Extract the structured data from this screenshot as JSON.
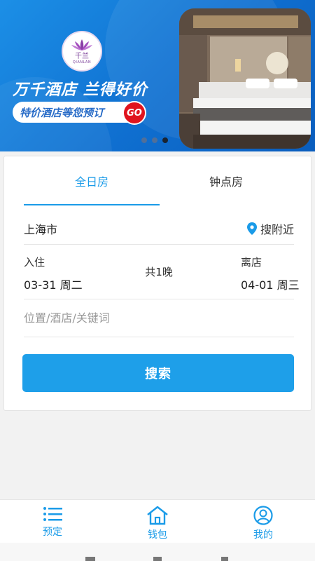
{
  "banner": {
    "logo_name": "千兰",
    "logo_sub": "QIANLAN",
    "slogan": "万千酒店 兰得好价",
    "pill_text": "特价酒店等您预订",
    "go_label": "GO",
    "carousel_count": 3,
    "carousel_active": 3
  },
  "tabs": {
    "all_day": "全日房",
    "hourly": "钟点房",
    "active": "全日房"
  },
  "location": {
    "city": "上海市",
    "nearby_label": "搜附近"
  },
  "dates": {
    "checkin_label": "入住",
    "checkin_value": "03-31 周二",
    "nights": "共1晚",
    "checkout_label": "离店",
    "checkout_value": "04-01 周三"
  },
  "keyword": {
    "placeholder": "位置/酒店/关键词"
  },
  "search_button": "搜索",
  "bottom_nav": {
    "book": "预定",
    "wallet": "钱包",
    "mine": "我的",
    "active": "预定"
  },
  "colors": {
    "accent": "#1e9fe9",
    "banner_blue": "#0f6fd0",
    "go_red": "#e0141e"
  }
}
